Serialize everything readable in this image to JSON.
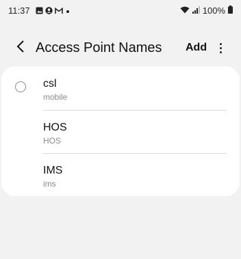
{
  "status_bar": {
    "time": "11:37",
    "battery": "100%",
    "notification_icons": [
      "gallery-icon",
      "account-icon",
      "gmail-icon",
      "dot-icon"
    ],
    "system_icons": [
      "wifi-icon",
      "signal-icon",
      "battery-icon"
    ]
  },
  "app_bar": {
    "title": "Access Point Names",
    "add_label": "Add",
    "back_icon": "chevron-left-icon",
    "more_icon": "more-vertical-icon"
  },
  "apn_list": [
    {
      "name": "csl",
      "type": "mobile",
      "selected": false
    },
    {
      "name": "HOS",
      "type": "HOS"
    },
    {
      "name": "IMS",
      "type": "ims"
    }
  ]
}
